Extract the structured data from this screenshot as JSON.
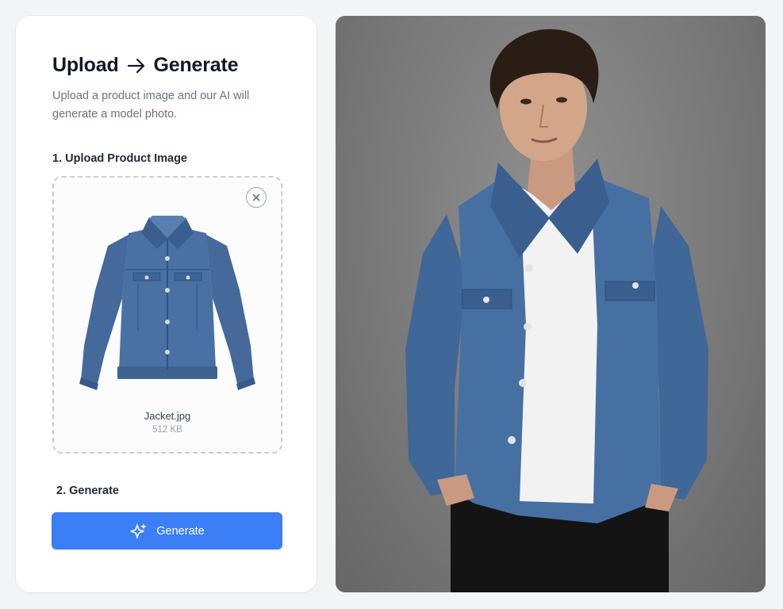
{
  "header": {
    "title_left": "Upload",
    "title_right": "Generate",
    "description": "Upload a product image and our AI will generate a model photo."
  },
  "upload": {
    "step_label": "1. Upload Product Image",
    "file_name": "Jacket.jpg",
    "file_size": "512 KB"
  },
  "generate": {
    "step_label": "2. Generate",
    "button_label": "Generate"
  },
  "icons": {
    "arrow": "arrow-right-icon",
    "remove": "close-icon",
    "sparkle": "sparkles-icon"
  },
  "colors": {
    "accent": "#3b7ef5",
    "title": "#111827",
    "muted": "#6b7280",
    "denim": "#3f6797"
  }
}
